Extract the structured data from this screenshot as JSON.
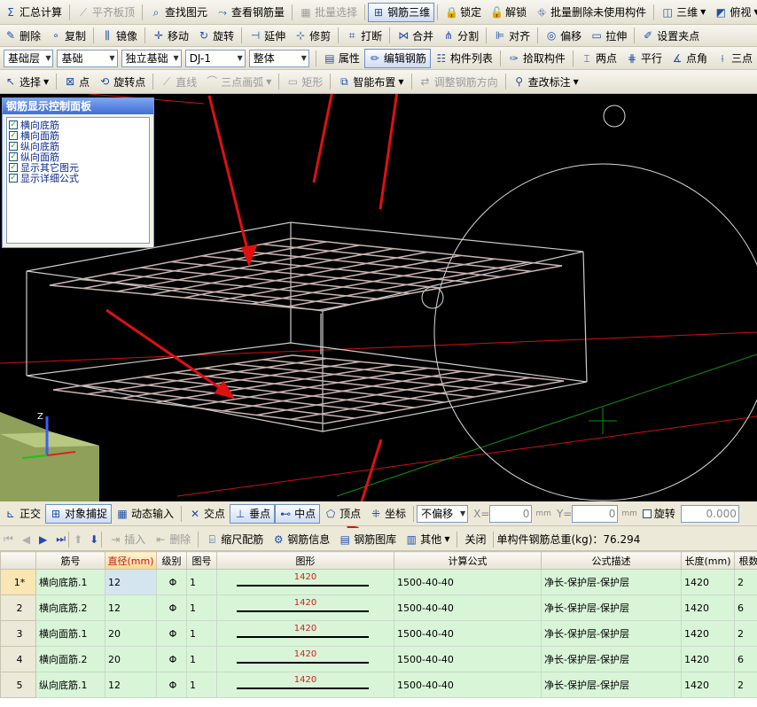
{
  "toolbar1": {
    "items": [
      {
        "icon": "sigma-icon",
        "glyph": "Σ",
        "label": "汇总计算",
        "disabled": false
      },
      {
        "icon": "flat-plate-icon",
        "glyph": "⟋",
        "label": "平齐板顶",
        "disabled": true
      },
      {
        "icon": "binoculars-icon",
        "glyph": "⌕",
        "label": "查找图元",
        "disabled": false
      },
      {
        "icon": "view-rebar-icon",
        "glyph": "⤳",
        "label": "查看钢筋量",
        "disabled": false
      },
      {
        "icon": "batch-select-icon",
        "glyph": "▦",
        "label": "批量选择",
        "disabled": true
      },
      {
        "icon": "rebar-3d-icon",
        "glyph": "⊞",
        "label": "钢筋三维",
        "disabled": false,
        "active": true
      },
      {
        "icon": "lock-icon",
        "glyph": "🔒",
        "label": "锁定",
        "disabled": false
      },
      {
        "icon": "unlock-icon",
        "glyph": "🔓",
        "label": "解锁",
        "disabled": false
      },
      {
        "icon": "batch-delete-icon",
        "glyph": "⛗",
        "label": "批量删除未使用构件",
        "disabled": false
      },
      {
        "icon": "view-3d-icon",
        "glyph": "◫",
        "label": "三维",
        "disabled": false,
        "dropdown": true
      },
      {
        "icon": "top-view-icon",
        "glyph": "◩",
        "label": "俯视",
        "disabled": false,
        "dropdown": true
      }
    ]
  },
  "toolbar2": {
    "items": [
      {
        "icon": "delete-icon",
        "glyph": "✎",
        "label": "删除"
      },
      {
        "icon": "copy-icon",
        "glyph": "∘",
        "label": "复制"
      },
      {
        "icon": "mirror-icon",
        "glyph": "⫼",
        "label": "镜像"
      },
      {
        "icon": "move-icon",
        "glyph": "✛",
        "label": "移动"
      },
      {
        "icon": "rotate-icon",
        "glyph": "↻",
        "label": "旋转"
      },
      {
        "icon": "extend-icon",
        "glyph": "⊣",
        "label": "延伸"
      },
      {
        "icon": "trim-icon",
        "glyph": "⊹",
        "label": "修剪"
      },
      {
        "icon": "break-icon",
        "glyph": "⌗",
        "label": "打断"
      },
      {
        "icon": "merge-icon",
        "glyph": "⋈",
        "label": "合并"
      },
      {
        "icon": "split-icon",
        "glyph": "⋔",
        "label": "分割"
      },
      {
        "icon": "align-icon",
        "glyph": "⊫",
        "label": "对齐"
      },
      {
        "icon": "offset-icon",
        "glyph": "◎",
        "label": "偏移"
      },
      {
        "icon": "stretch-icon",
        "glyph": "▭",
        "label": "拉伸"
      },
      {
        "icon": "set-clamp-icon",
        "glyph": "✐",
        "label": "设置夹点"
      }
    ]
  },
  "toolbar3": {
    "floor": "基础层",
    "category": "基础",
    "type": "独立基础",
    "element": "DJ-1",
    "scope": "整体",
    "buttons": [
      {
        "icon": "property-icon",
        "glyph": "▤",
        "label": "属性"
      },
      {
        "icon": "edit-rebar-icon",
        "glyph": "✏",
        "label": "编辑钢筋",
        "active": true
      },
      {
        "icon": "component-list-icon",
        "glyph": "☷",
        "label": "构件列表"
      },
      {
        "icon": "pick-component-icon",
        "glyph": "✑",
        "label": "拾取构件"
      },
      {
        "icon": "two-point-icon",
        "glyph": "⌶",
        "label": "两点"
      },
      {
        "icon": "parallel-icon",
        "glyph": "⋕",
        "label": "平行"
      },
      {
        "icon": "point-angle-icon",
        "glyph": "∡",
        "label": "点角"
      },
      {
        "icon": "three-point-icon",
        "glyph": "⟊",
        "label": "三点"
      }
    ]
  },
  "toolbar4": {
    "items": [
      {
        "icon": "select-icon",
        "glyph": "↖",
        "label": "选择",
        "dropdown": true
      },
      {
        "icon": "point-icon",
        "glyph": "⊠",
        "label": "点"
      },
      {
        "icon": "rotate-point-icon",
        "glyph": "⟲",
        "label": "旋转点"
      },
      {
        "icon": "line-icon",
        "glyph": "⟋",
        "label": "直线",
        "disabled": true
      },
      {
        "icon": "arc-icon",
        "glyph": "⌒",
        "label": "三点画弧",
        "disabled": true,
        "dropdown": true
      },
      {
        "icon": "rect-icon",
        "glyph": "▭",
        "label": "矩形",
        "disabled": true
      },
      {
        "icon": "smart-layout-icon",
        "glyph": "⧉",
        "label": "智能布置",
        "dropdown": true
      },
      {
        "icon": "adjust-direction-icon",
        "glyph": "⇄",
        "label": "调整钢筋方向",
        "disabled": true
      },
      {
        "icon": "change-label-icon",
        "glyph": "⚲",
        "label": "查改标注",
        "dropdown": true
      }
    ]
  },
  "panel": {
    "title": "钢筋显示控制面板",
    "items": [
      "横向底筋",
      "横向面筋",
      "纵向底筋",
      "纵向面筋",
      "显示其它图元",
      "显示详细公式"
    ]
  },
  "snapbar": {
    "items": [
      {
        "icon": "ortho-icon",
        "glyph": "⊾",
        "label": "正交"
      },
      {
        "icon": "object-snap-icon",
        "glyph": "⊞",
        "label": "对象捕捉",
        "active": true
      },
      {
        "icon": "dynamic-input-icon",
        "glyph": "▦",
        "label": "动态输入"
      },
      {
        "icon": "intersection-icon",
        "glyph": "✕",
        "label": "交点"
      },
      {
        "icon": "perpendicular-icon",
        "glyph": "⊥",
        "label": "垂点",
        "active": true
      },
      {
        "icon": "midpoint-icon",
        "glyph": "⊷",
        "label": "中点",
        "active": true
      },
      {
        "icon": "vertex-icon",
        "glyph": "⬠",
        "label": "顶点"
      },
      {
        "icon": "coordinate-icon",
        "glyph": "⁜",
        "label": "坐标"
      }
    ],
    "offset_mode": "不偏移",
    "x_label": "X=",
    "x_value": "0",
    "y_label": "Y=",
    "y_value": "0",
    "unit": "mm",
    "rotate_label": "旋转",
    "rotate_value": "0.000"
  },
  "grid_toolbar": {
    "buttons": [
      {
        "icon": "insert-icon",
        "glyph": "⇥",
        "label": "插入",
        "disabled": true
      },
      {
        "icon": "row-delete-icon",
        "glyph": "⇤",
        "label": "删除",
        "disabled": true
      },
      {
        "icon": "scale-rebar-icon",
        "glyph": "⌸",
        "label": "缩尺配筋"
      },
      {
        "icon": "rebar-info-icon",
        "glyph": "⚙",
        "label": "钢筋信息"
      },
      {
        "icon": "rebar-library-icon",
        "glyph": "▤",
        "label": "钢筋图库"
      },
      {
        "icon": "other-icon",
        "glyph": "▥",
        "label": "其他",
        "dropdown": true
      },
      {
        "icon": "",
        "glyph": "",
        "label": "关闭"
      }
    ],
    "total_label": "单构件钢筋总重(kg)：76.294"
  },
  "table": {
    "headers": [
      "",
      "筋号",
      "直径(mm)",
      "级别",
      "图号",
      "图形",
      "计算公式",
      "公式描述",
      "长度(mm)",
      "根数"
    ],
    "rows": [
      {
        "idx": "1*",
        "name": "横向底筋.1",
        "dia": "12",
        "grade": "Φ",
        "fig": "1",
        "shape": "1420",
        "formula": "1500-40-40",
        "desc": "净长-保护层-保护层",
        "length": "1420",
        "count": "2"
      },
      {
        "idx": "2",
        "name": "横向底筋.2",
        "dia": "12",
        "grade": "Φ",
        "fig": "1",
        "shape": "1420",
        "formula": "1500-40-40",
        "desc": "净长-保护层-保护层",
        "length": "1420",
        "count": "6"
      },
      {
        "idx": "3",
        "name": "横向面筋.1",
        "dia": "20",
        "grade": "Φ",
        "fig": "1",
        "shape": "1420",
        "formula": "1500-40-40",
        "desc": "净长-保护层-保护层",
        "length": "1420",
        "count": "2"
      },
      {
        "idx": "4",
        "name": "横向面筋.2",
        "dia": "20",
        "grade": "Φ",
        "fig": "1",
        "shape": "1420",
        "formula": "1500-40-40",
        "desc": "净长-保护层-保护层",
        "length": "1420",
        "count": "6"
      },
      {
        "idx": "5",
        "name": "纵向底筋.1",
        "dia": "12",
        "grade": "Φ",
        "fig": "1",
        "shape": "1420",
        "formula": "1500-40-40",
        "desc": "净长-保护层-保护层",
        "length": "1420",
        "count": "2"
      }
    ]
  },
  "colors": {
    "viewport_bg": "#000000",
    "rebar": "#c9b3b0",
    "annotation_arrow": "#e01010",
    "axis_red": "#d01010",
    "axis_green": "#108f10"
  }
}
